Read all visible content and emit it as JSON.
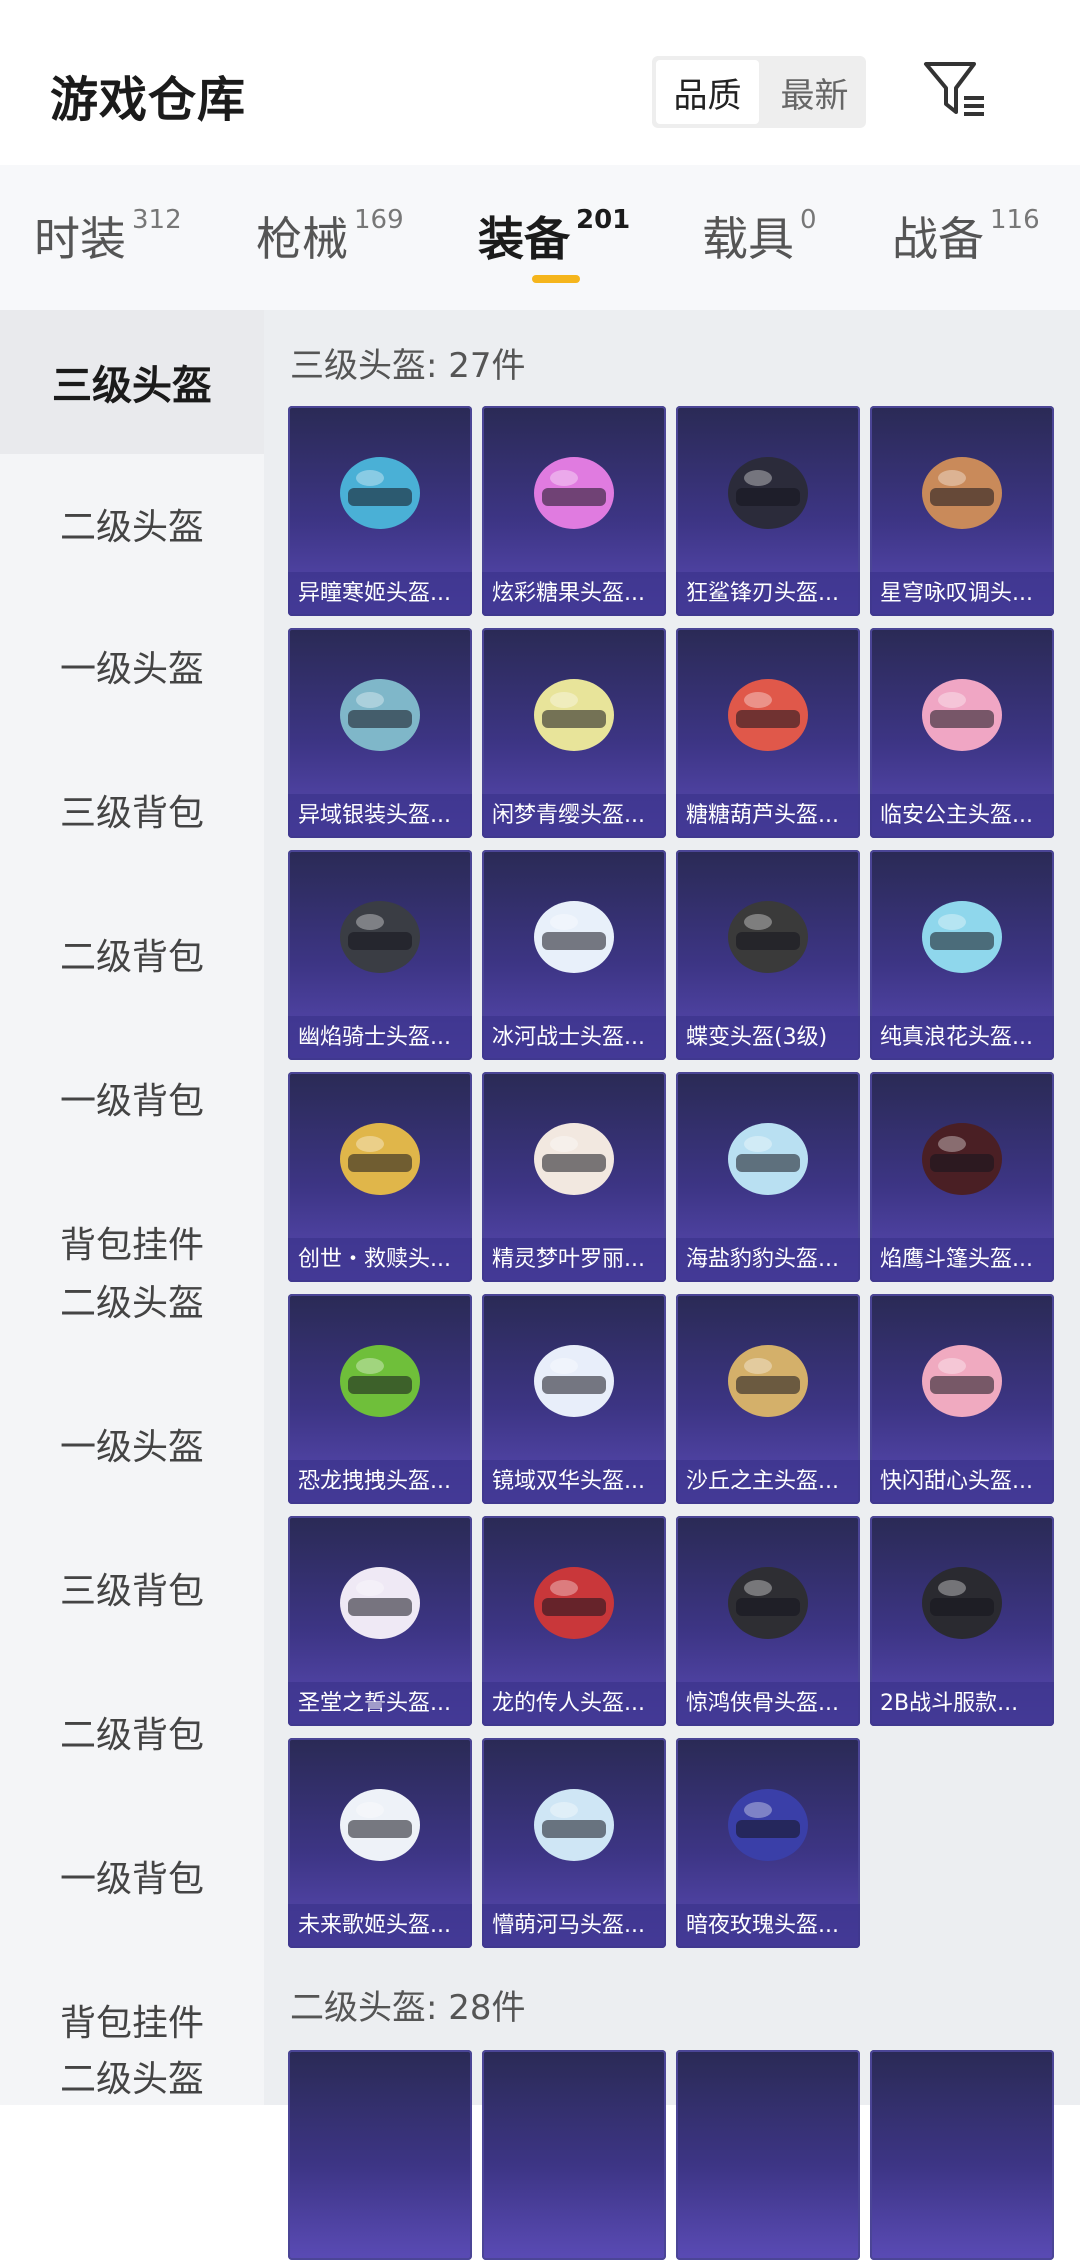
{
  "header": {
    "title": "游戏仓库",
    "sort_options": [
      "品质",
      "最新"
    ],
    "active_sort": 0
  },
  "tabs": [
    {
      "label": "时装",
      "count": "312"
    },
    {
      "label": "枪械",
      "count": "169"
    },
    {
      "label": "装备",
      "count": "201"
    },
    {
      "label": "载具",
      "count": "0"
    },
    {
      "label": "战备",
      "count": "116"
    }
  ],
  "active_tab": 2,
  "sidebar": {
    "items": [
      "三级头盔",
      "二级头盔",
      "一级头盔",
      "三级背包",
      "二级背包",
      "一级背包",
      "背包挂件",
      "二级头盔",
      "一级头盔",
      "三级背包",
      "二级背包",
      "一级背包",
      "背包挂件",
      "二级头盔"
    ]
  },
  "sections": [
    {
      "title": "三级头盔: 27件",
      "items": [
        {
          "name": "异瞳寒姬头盔...",
          "color": "#4ab0d6"
        },
        {
          "name": "炫彩糖果头盔...",
          "color": "#e07be0"
        },
        {
          "name": "狂鲨锋刃头盔...",
          "color": "#2b2b3a"
        },
        {
          "name": "星穹咏叹调头...",
          "color": "#c98a5a"
        },
        {
          "name": "异域银装头盔...",
          "color": "#7fb7c9"
        },
        {
          "name": "闲梦青缨头盔...",
          "color": "#e8e49a"
        },
        {
          "name": "糖糖葫芦头盔...",
          "color": "#e0584a"
        },
        {
          "name": "临安公主头盔...",
          "color": "#f0a6c4"
        },
        {
          "name": "幽焰骑士头盔...",
          "color": "#3a3d44"
        },
        {
          "name": "冰河战士头盔...",
          "color": "#e8f0fa"
        },
        {
          "name": "蝶变头盔(3级)",
          "color": "#3a3a3a"
        },
        {
          "name": "纯真浪花头盔...",
          "color": "#8fd7ec"
        },
        {
          "name": "创世・救赎头...",
          "color": "#e0b64a"
        },
        {
          "name": "精灵梦叶罗丽...",
          "color": "#f2e8e0"
        },
        {
          "name": "海盐豹豹头盔...",
          "color": "#b9e0f2"
        },
        {
          "name": "焰鹰斗篷头盔...",
          "color": "#4a1f24"
        },
        {
          "name": "恐龙拽拽头盔...",
          "color": "#6fbf3a"
        },
        {
          "name": "镜域双华头盔...",
          "color": "#e8eefa"
        },
        {
          "name": "沙丘之主头盔...",
          "color": "#d4b06a"
        },
        {
          "name": "快闪甜心头盔...",
          "color": "#f0aac0"
        },
        {
          "name": "圣堂之誓头盔...",
          "color": "#efe9f5"
        },
        {
          "name": "龙的传人头盔...",
          "color": "#c9373a"
        },
        {
          "name": "惊鸿侠骨头盔...",
          "color": "#2e2e33"
        },
        {
          "name": "2B战斗服款...",
          "color": "#2a2a30"
        },
        {
          "name": "未来歌姬头盔...",
          "color": "#eef2f8"
        },
        {
          "name": "懵萌河马头盔...",
          "color": "#cfe6f5"
        },
        {
          "name": "暗夜玫瑰头盔...",
          "color": "#3a3fa8"
        }
      ]
    },
    {
      "title": "二级头盔: 28件"
    }
  ]
}
